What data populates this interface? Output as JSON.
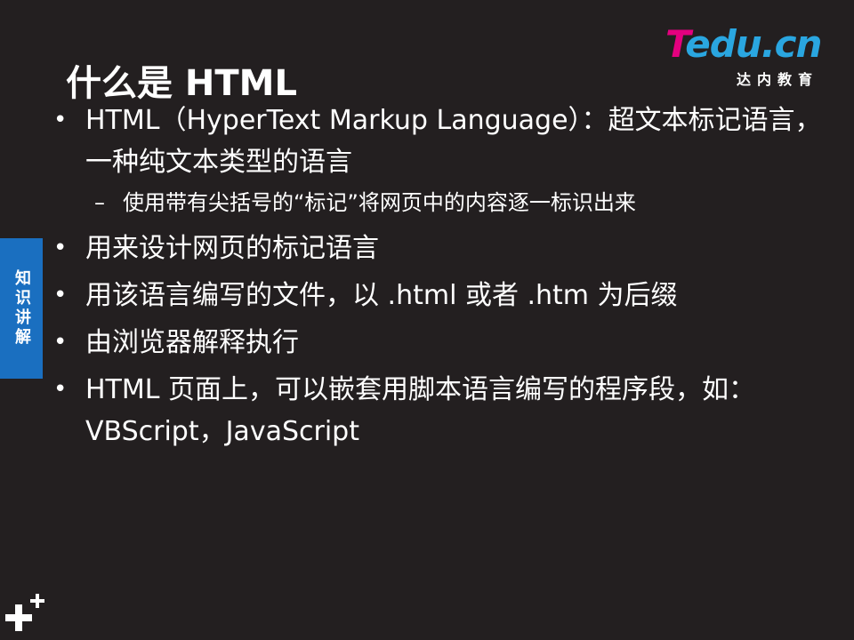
{
  "brand": {
    "logo_t": "T",
    "logo_rest": "edu.cn",
    "logo_subtitle": "达内教育"
  },
  "slide": {
    "title": "什么是 HTML",
    "side_tab": "知识讲解",
    "bullets": [
      "HTML（HyperText Markup Language）：超文本标记语言，一种纯文本类型的语言",
      "用来设计网页的标记语言",
      "用该语言编写的文件，以 .html 或者 .htm 为后缀",
      "由浏览器解释执行",
      "HTML 页面上，可以嵌套用脚本语言编写的程序段，如：VBScript，JavaScript"
    ],
    "sub_bullets": [
      "使用带有尖括号的“标记”将网页中的内容逐一标识出来"
    ]
  },
  "icons": {
    "corner": "plus-plus-icon"
  },
  "colors": {
    "background": "#231f20",
    "side_tab": "#1a6fc0",
    "logo_pink": "#e4007f",
    "logo_blue": "#2aa6e0"
  }
}
